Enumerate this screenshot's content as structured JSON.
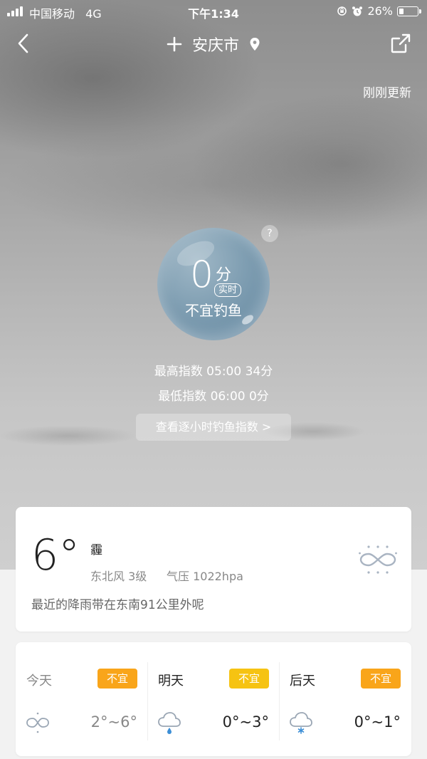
{
  "status_bar": {
    "carrier": "中国移动",
    "network": "4G",
    "time": "下午1:34",
    "battery": "26%",
    "battery_level": 0.26
  },
  "header": {
    "city": "安庆市",
    "updated": "刚刚更新"
  },
  "fishing": {
    "score": "0",
    "unit": "分",
    "realtime_tag": "实时",
    "verdict": "不宜钓鱼",
    "help": "?",
    "max_index": "最高指数 05:00 34分",
    "min_index": "最低指数 06:00 0分",
    "hourly_button": "查看逐小时钓鱼指数 >"
  },
  "current_weather": {
    "temperature": "6°",
    "condition": "霾",
    "wind": "东北风 3级",
    "pressure": "气压 1022hpa",
    "rain_note": "最近的降雨带在东南91公里外呢",
    "icon": "haze-icon"
  },
  "forecast": [
    {
      "day": "今天",
      "tag": "不宜",
      "tag_color": "#f9a51a",
      "range": "2°~6°",
      "icon": "haze-icon"
    },
    {
      "day": "明天",
      "tag": "不宜",
      "tag_color": "#f6c312",
      "range": "0°~3°",
      "icon": "rain-icon"
    },
    {
      "day": "后天",
      "tag": "不宜",
      "tag_color": "#f9a51a",
      "range": "0°~1°",
      "icon": "snow-icon"
    }
  ],
  "colors": {
    "accent_orange": "#f9a51a",
    "accent_yellow": "#f6c312",
    "bubble_blue": "#7f9eb2"
  }
}
